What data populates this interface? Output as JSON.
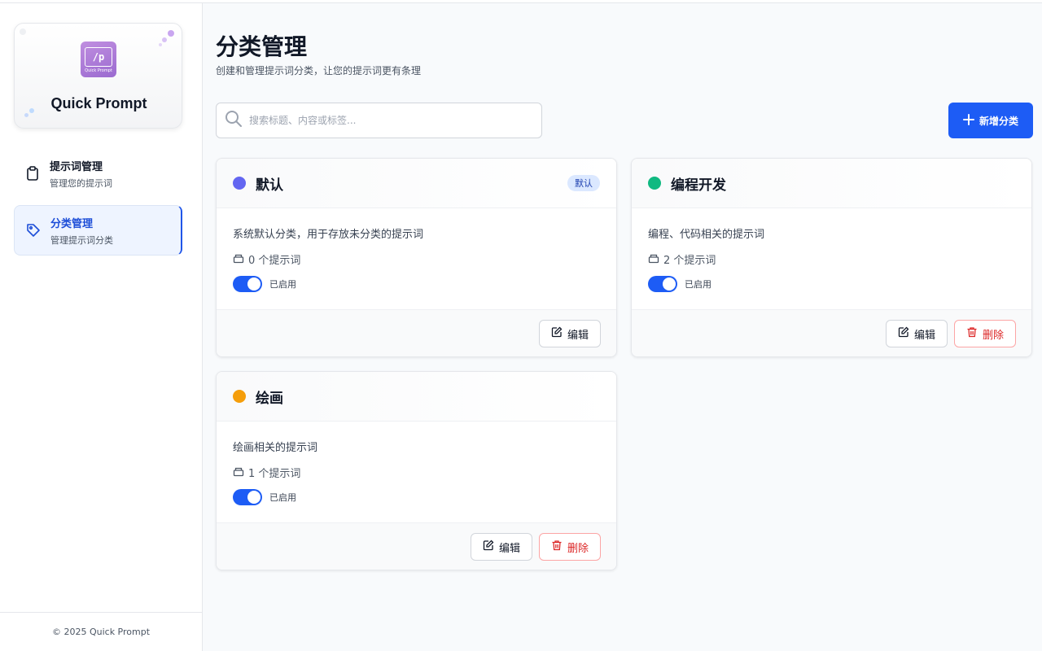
{
  "app": {
    "name": "Quick Prompt",
    "logo_text": "/p",
    "logo_sub": "Quick Prompt",
    "footer": "© 2025 Quick Prompt"
  },
  "sidebar": {
    "items": [
      {
        "title": "提示词管理",
        "subtitle": "管理您的提示词",
        "icon": "clipboard-icon",
        "active": false
      },
      {
        "title": "分类管理",
        "subtitle": "管理提示词分类",
        "icon": "tag-icon",
        "active": true
      }
    ]
  },
  "main": {
    "title": "分类管理",
    "subtitle": "创建和管理提示词分类，让您的提示词更有条理",
    "search_placeholder": "搜索标题、内容或标签...",
    "add_button": "新增分类"
  },
  "categories": [
    {
      "name": "默认",
      "color": "#6366f1",
      "badge": "默认",
      "description": "系统默认分类，用于存放未分类的提示词",
      "count_text": "0 个提示词",
      "enabled_label": "已启用",
      "enabled": true,
      "edit_label": "编辑",
      "delete_label": ""
    },
    {
      "name": "编程开发",
      "color": "#10b981",
      "badge": "",
      "description": "编程、代码相关的提示词",
      "count_text": "2 个提示词",
      "enabled_label": "已启用",
      "enabled": true,
      "edit_label": "编辑",
      "delete_label": "删除"
    },
    {
      "name": "绘画",
      "color": "#f59e0b",
      "badge": "",
      "description": "绘画相关的提示词",
      "count_text": "1 个提示词",
      "enabled_label": "已启用",
      "enabled": true,
      "edit_label": "编辑",
      "delete_label": "删除"
    }
  ],
  "colors": {
    "accent": "#1d5cf5",
    "danger": "#dc2626"
  }
}
